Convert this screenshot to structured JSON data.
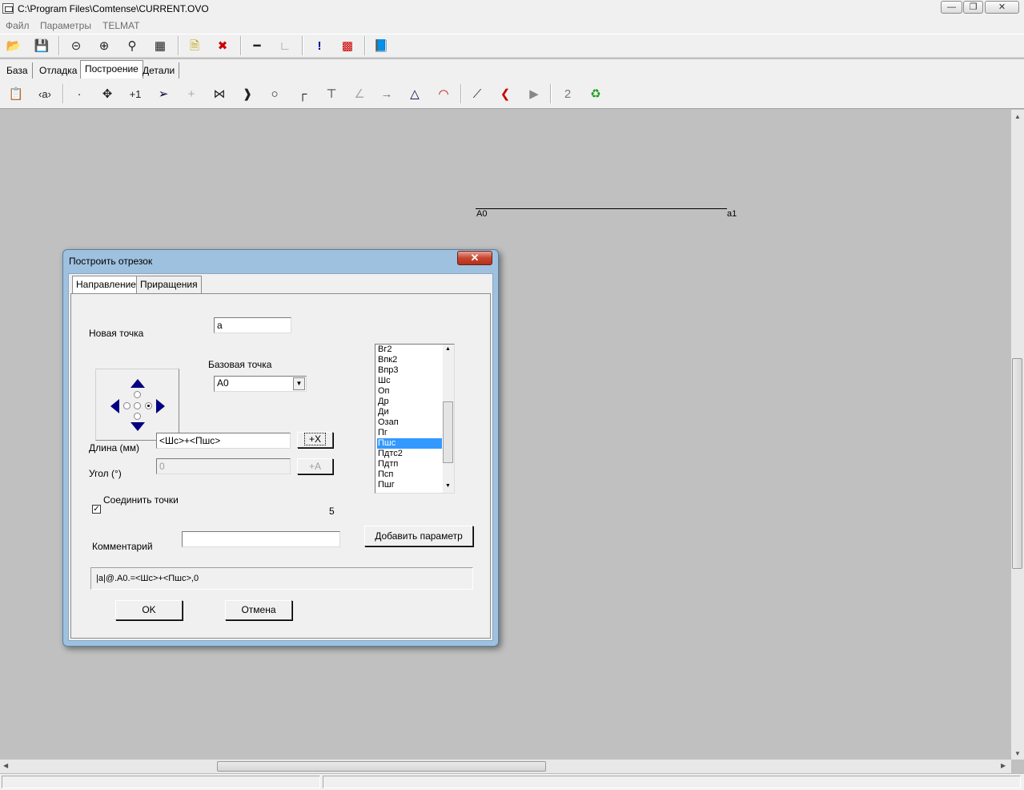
{
  "window": {
    "title": "C:\\Program Files\\Comtense\\CURRENT.OVO"
  },
  "menu": {
    "items": [
      "Файл",
      "Параметры",
      "TELMAT"
    ]
  },
  "app_tabs": [
    "База",
    "Отладка",
    "Построение",
    "Детали"
  ],
  "app_tabs_active": "Построение",
  "toolbar2": {
    "text_tool": "2"
  },
  "canvas": {
    "start_label": "A0",
    "end_label": "a1"
  },
  "dialog": {
    "title": "Построить отрезок",
    "tabs": [
      "Направление",
      "Приращения"
    ],
    "active_tab": "Направление",
    "new_point_label": "Новая точка",
    "new_point_value": "a",
    "base_point_label": "Базовая точка",
    "base_point_value": "A0",
    "length_label": "Длина (мм)",
    "length_value": "<Шс>+<Пшс>",
    "length_button": "+X",
    "angle_label": "Угол (°)",
    "angle_value": "0",
    "angle_button": "+A",
    "connect_label": "Соединить точки",
    "connect_checked": true,
    "count_value": "5",
    "comment_label": "Комментарий",
    "comment_value": "",
    "add_param_button": "Добавить параметр",
    "formula": "|a|@.A0.=<Шс>+<Пшс>,0",
    "ok_button": "OK",
    "cancel_button": "Отмена",
    "params_list": [
      "Вг2",
      "Впк2",
      "Впр3",
      "Шс",
      "Оп",
      "Др",
      "Ди",
      "Озап",
      "Пг",
      "Пшс",
      "Пдтс2",
      "Пдтп",
      "Псп",
      "Пшг"
    ],
    "params_selected": "Пшс",
    "direction_selected": "right"
  }
}
